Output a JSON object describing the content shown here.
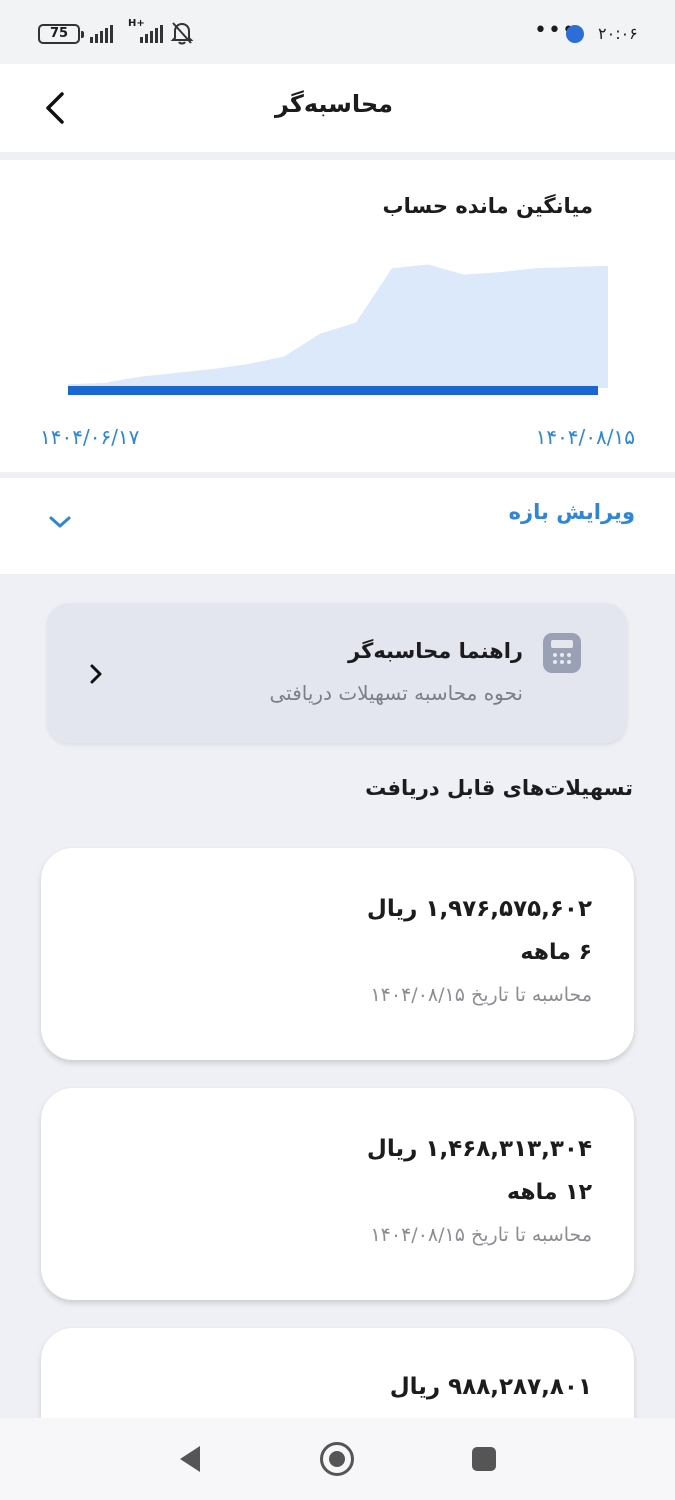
{
  "status_bar": {
    "battery": "75",
    "network": "H+",
    "time": "۲۰:۰۶",
    "dots": "•••"
  },
  "header": {
    "title": "محاسبه‌گر"
  },
  "chart": {
    "title": "میانگین مانده حساب",
    "start_date": "۱۴۰۴/۰۶/۱۷",
    "end_date": "۱۴۰۴/۰۸/۱۵",
    "fill_color": "#dbe9fa",
    "bar_color": "#1a66d2"
  },
  "chart_data": {
    "type": "area",
    "title": "میانگین مانده حساب",
    "x": [
      "۱۴۰۴/۰۶/۱۷",
      "",
      "",
      "",
      "",
      "",
      "",
      "",
      "",
      "",
      "",
      "",
      "",
      "",
      "",
      "۱۴۰۴/۰۸/۱۵"
    ],
    "series": [
      {
        "values": [
          3,
          4,
          9,
          12,
          15,
          19,
          25,
          43,
          52,
          95,
          98,
          90,
          92,
          95,
          96,
          97
        ]
      }
    ],
    "ylim": [
      0,
      100
    ],
    "grid": false,
    "legend": "none"
  },
  "range_editor": {
    "label": "ویرایش بازه"
  },
  "guide": {
    "title": "راهنما محاسبه‌گر",
    "subtitle": "نحوه محاسبه تسهیلات دریافتی"
  },
  "section": {
    "title": "تسهیلات‌های قابل دریافت"
  },
  "loans": [
    {
      "amount": "۱,۹۷۶,۵۷۵,۶۰۲ ریال",
      "term": "۶ ماهه",
      "calc_date": "محاسبه تا تاریخ ۱۴۰۴/۰۸/۱۵"
    },
    {
      "amount": "۱,۴۶۸,۳۱۳,۳۰۴ ریال",
      "term": "۱۲ ماهه",
      "calc_date": "محاسبه تا تاریخ ۱۴۰۴/۰۸/۱۵"
    },
    {
      "amount": "۹۸۸,۲۸۷,۸۰۱ ریال"
    }
  ]
}
